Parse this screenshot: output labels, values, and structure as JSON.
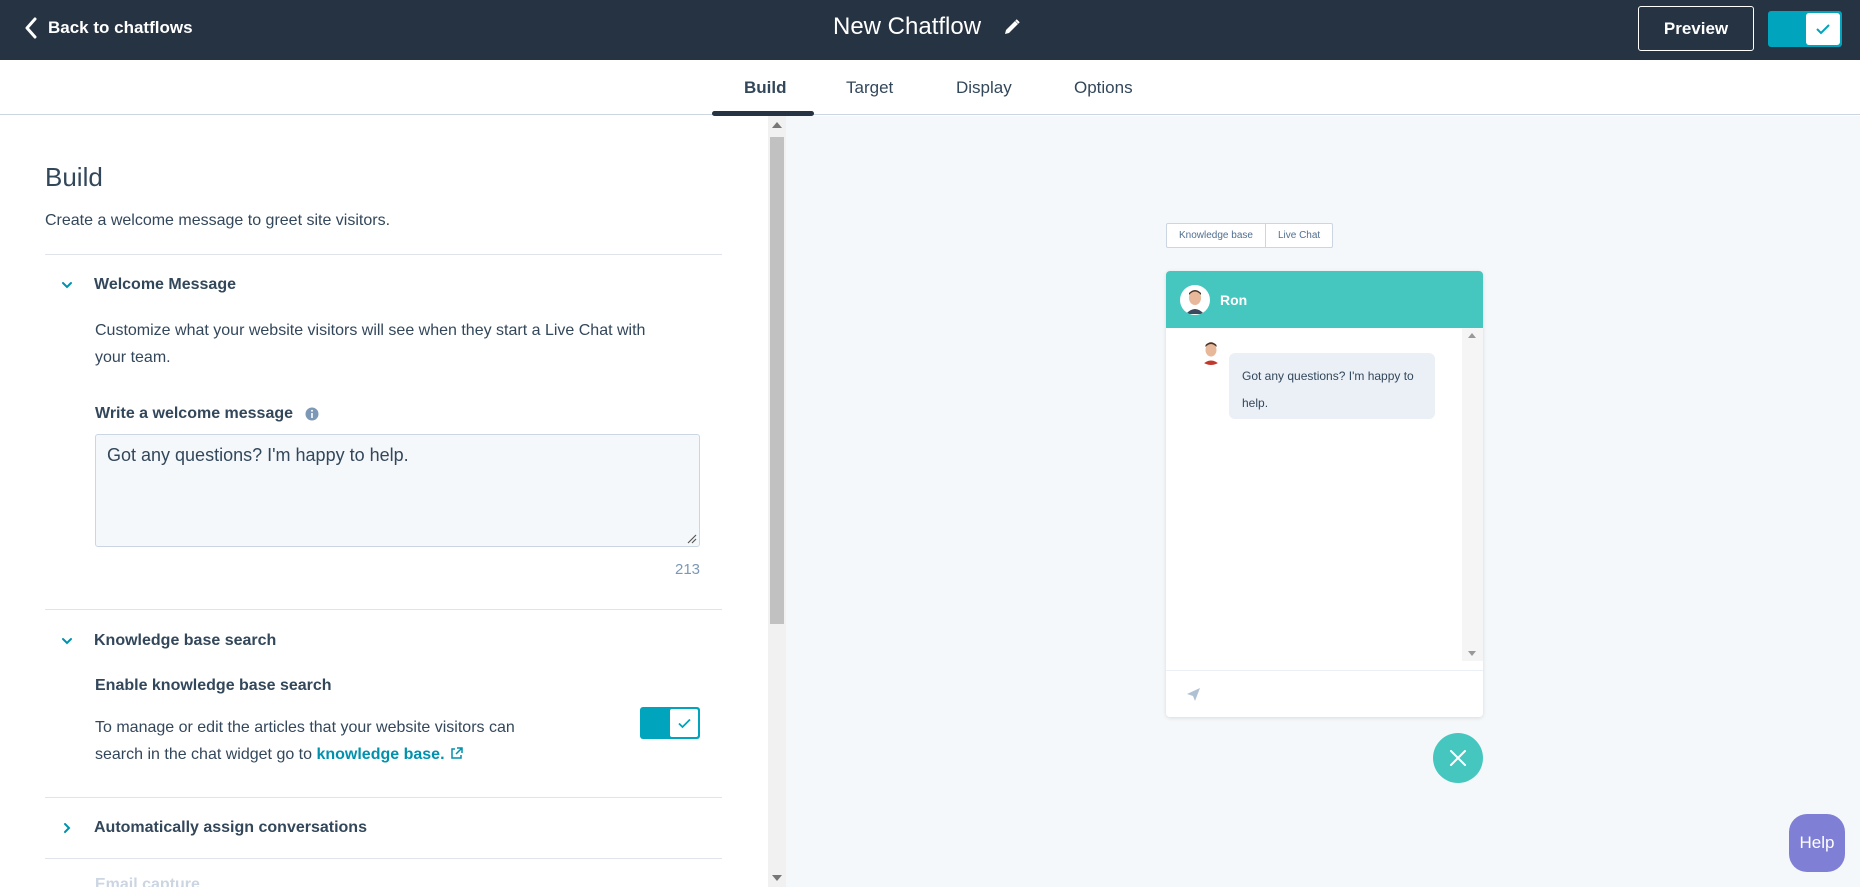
{
  "header": {
    "back_label": "Back to chatflows",
    "title": "New Chatflow",
    "preview_label": "Preview",
    "publish_toggle_on": true
  },
  "tabs": [
    {
      "label": "Build",
      "active": true
    },
    {
      "label": "Target",
      "active": false
    },
    {
      "label": "Display",
      "active": false
    },
    {
      "label": "Options",
      "active": false
    }
  ],
  "build": {
    "heading": "Build",
    "subheading": "Create a welcome message to greet site visitors.",
    "welcome": {
      "title": "Welcome Message",
      "description_line1": "Customize what your website visitors will see when they start a Live Chat with",
      "description_line2": "your team.",
      "field_label": "Write a welcome message",
      "value": "Got any questions? I'm happy to help.",
      "char_count": "213"
    },
    "knowledge": {
      "title": "Knowledge base search",
      "enable_label": "Enable knowledge base search",
      "desc_line1": "To manage or edit the articles that your website visitors can",
      "desc_line2_prefix": "search in the chat widget go to ",
      "link_text": "knowledge base.",
      "enabled": true
    },
    "assign": {
      "title": "Automatically assign conversations"
    },
    "next_section_partial": "Email capture"
  },
  "preview": {
    "tabs": [
      "Knowledge base",
      "Live Chat"
    ],
    "agent_name": "Ron",
    "message": "Got any questions? I'm happy to help.",
    "message_line1": "Got any questions? I'm happy to",
    "message_line2": "help."
  },
  "help_label": "Help",
  "colors": {
    "topbar": "#253342",
    "accent": "#00a4bd",
    "chat_header": "#45c7c0",
    "help": "#7f7fd5"
  }
}
